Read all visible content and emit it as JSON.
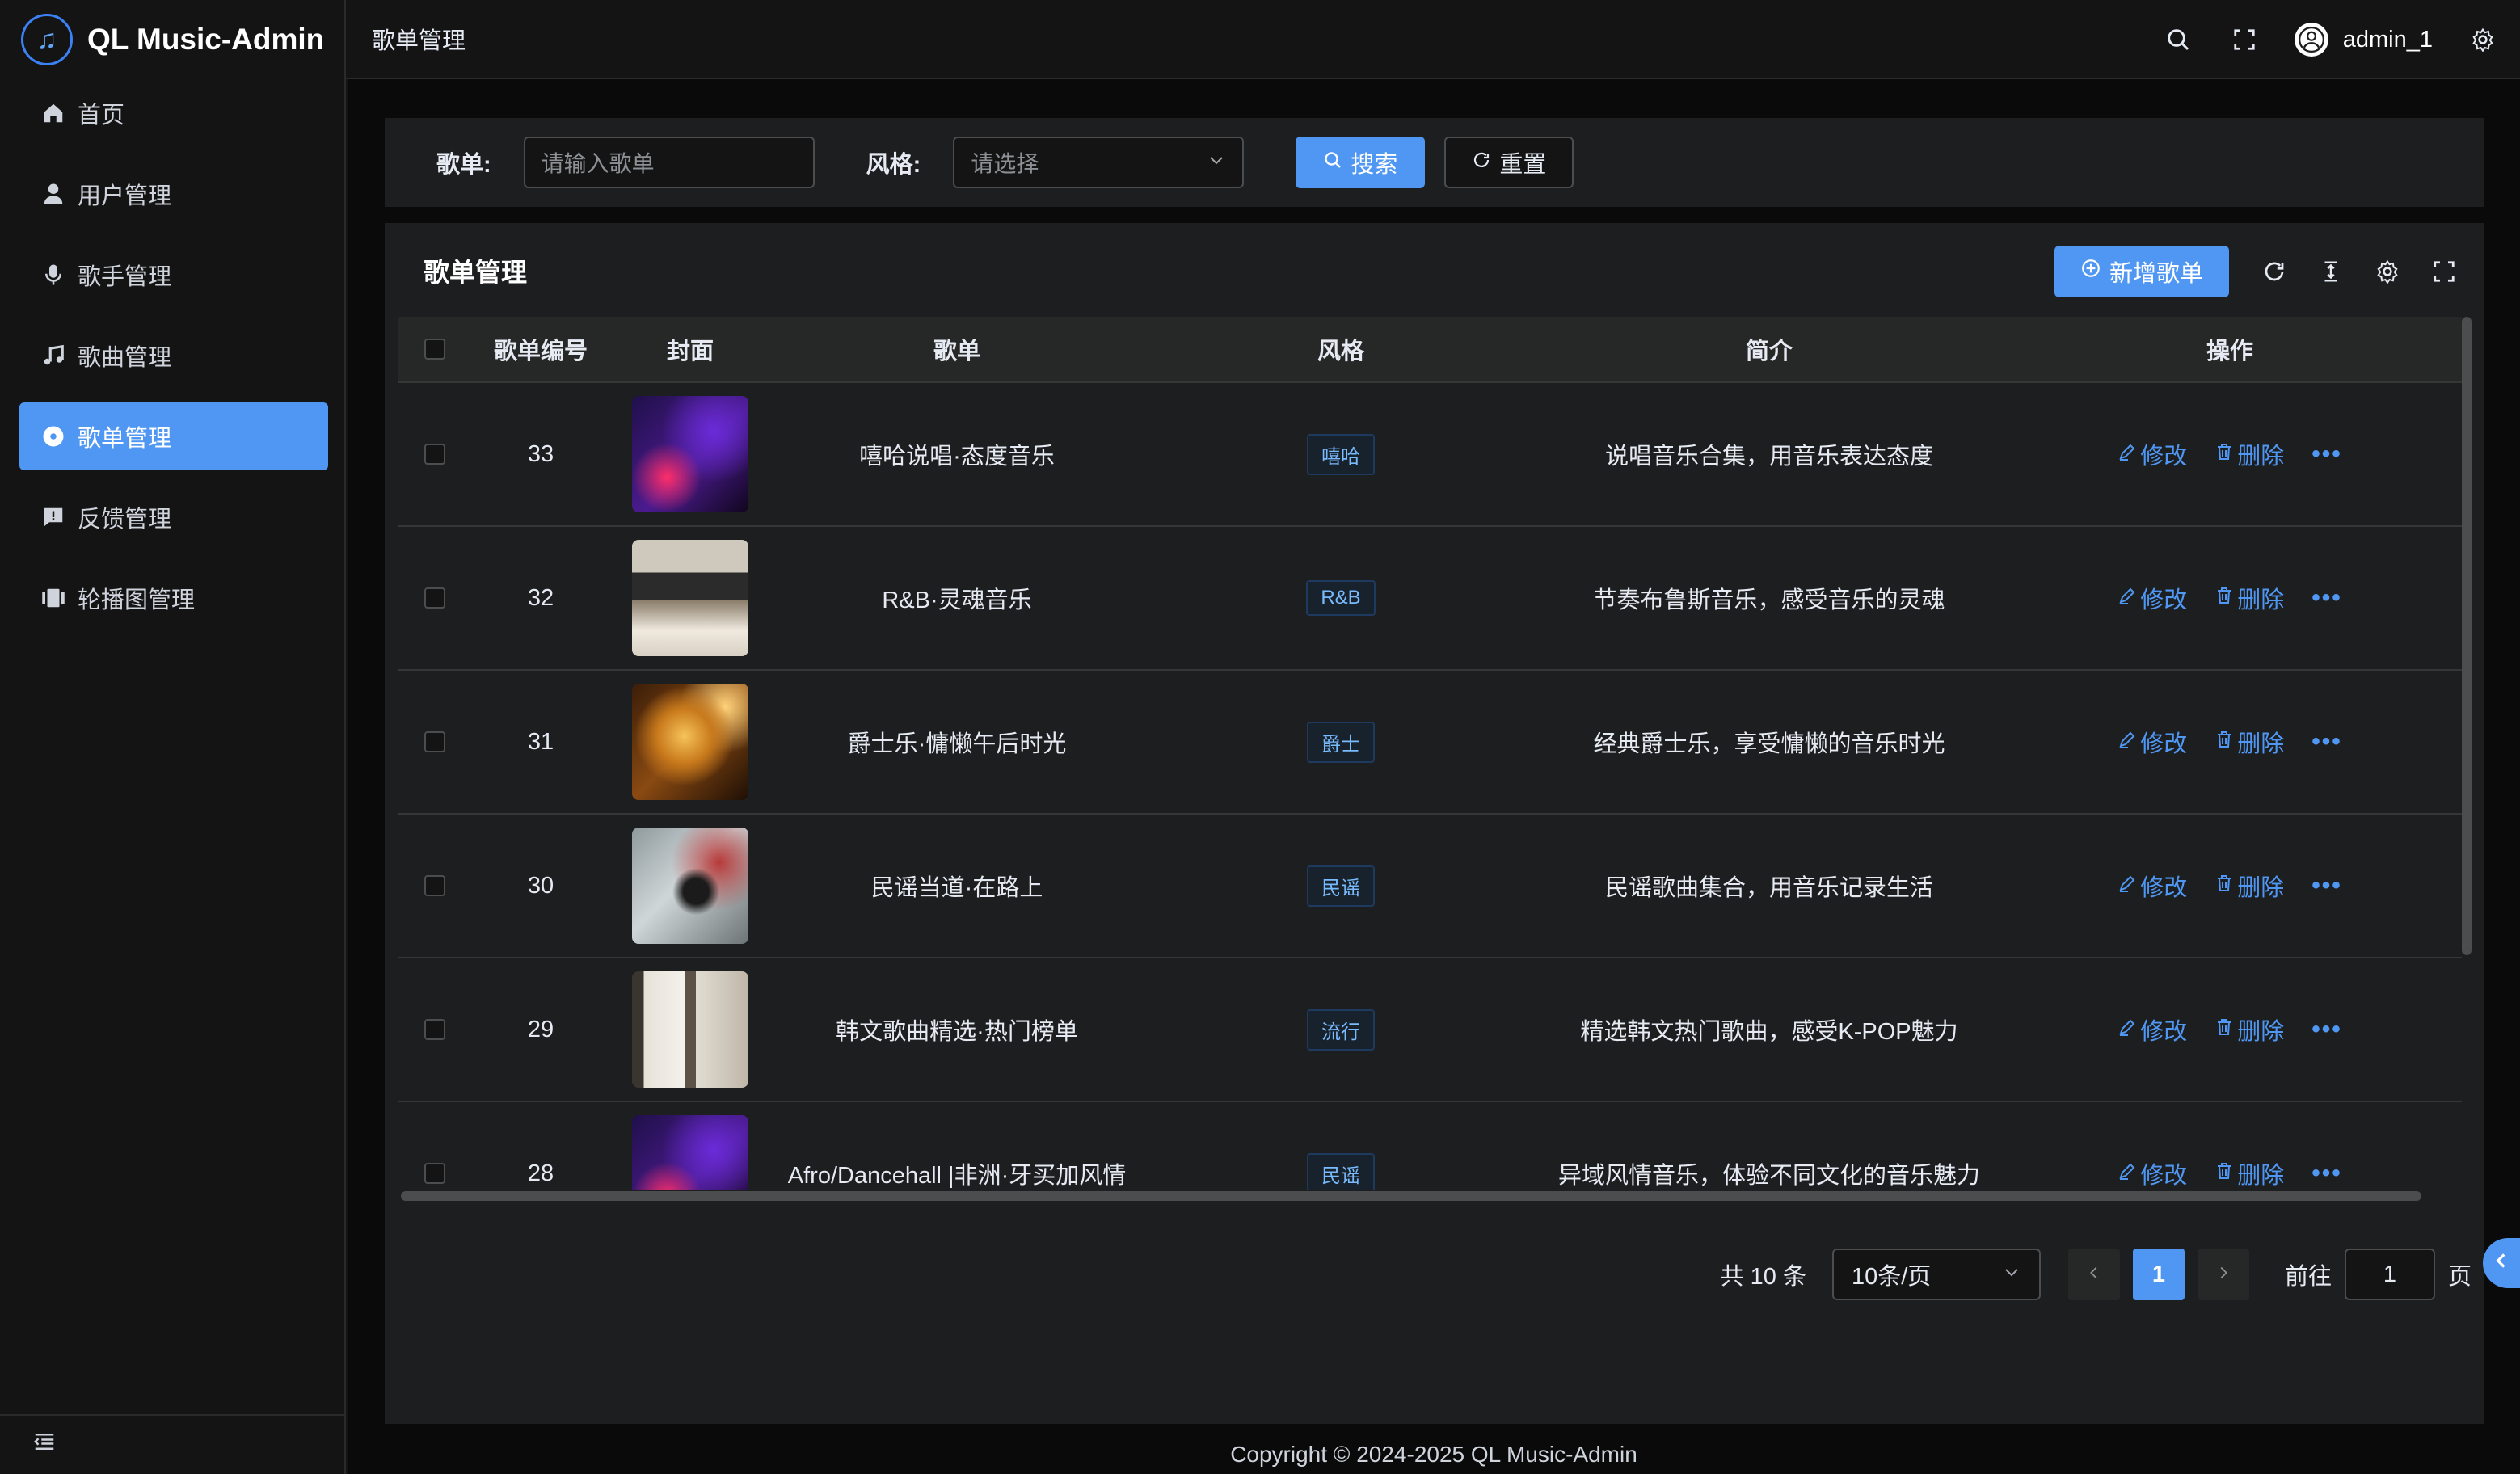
{
  "app": {
    "title": "QL Music-Admin",
    "accent": "#4f97f2"
  },
  "sidebar": {
    "items": [
      {
        "label": "首页",
        "icon": "home-icon"
      },
      {
        "label": "用户管理",
        "icon": "user-icon"
      },
      {
        "label": "歌手管理",
        "icon": "microphone-icon"
      },
      {
        "label": "歌曲管理",
        "icon": "music-note-icon"
      },
      {
        "label": "歌单管理",
        "icon": "disc-icon",
        "active": true
      },
      {
        "label": "反馈管理",
        "icon": "feedback-icon"
      },
      {
        "label": "轮播图管理",
        "icon": "carousel-icon"
      }
    ],
    "collapse_icon": "collapse-icon"
  },
  "header": {
    "breadcrumb": "歌单管理",
    "username": "admin_1"
  },
  "search": {
    "playlist_label": "歌单:",
    "playlist_placeholder": "请输入歌单",
    "style_label": "风格:",
    "style_placeholder": "请选择",
    "search_button": "搜索",
    "reset_button": "重置"
  },
  "table_card": {
    "title": "歌单管理",
    "add_button": "新增歌单"
  },
  "table": {
    "headers": {
      "id": "歌单编号",
      "cover": "封面",
      "name": "歌单",
      "style": "风格",
      "desc": "简介",
      "ops": "操作"
    },
    "edit_label": "修改",
    "delete_label": "删除",
    "more_label": "•••",
    "rows": [
      {
        "id": "33",
        "name": "嘻哈说唱·态度音乐",
        "style": "嘻哈",
        "desc": "说唱音乐合集，用音乐表达态度"
      },
      {
        "id": "32",
        "name": "R&B·灵魂音乐",
        "style": "R&B",
        "desc": "节奏布鲁斯音乐，感受音乐的灵魂"
      },
      {
        "id": "31",
        "name": "爵士乐·慵懒午后时光",
        "style": "爵士",
        "desc": "经典爵士乐，享受慵懒的音乐时光"
      },
      {
        "id": "30",
        "name": "民谣当道·在路上",
        "style": "民谣",
        "desc": "民谣歌曲集合，用音乐记录生活"
      },
      {
        "id": "29",
        "name": "韩文歌曲精选·热门榜单",
        "style": "流行",
        "desc": "精选韩文热门歌曲，感受K-POP魅力"
      },
      {
        "id": "28",
        "name": "Afro/Dancehall |非洲·牙买加风情",
        "style": "民谣",
        "desc": "异域风情音乐，体验不同文化的音乐魅力"
      }
    ]
  },
  "pagination": {
    "total": "共 10 条",
    "page_size": "10条/页",
    "current_page": "1",
    "goto_label": "前往",
    "goto_value": "1",
    "page_suffix": "页"
  },
  "footer": {
    "copyright": "Copyright © 2024-2025    QL Music-Admin"
  }
}
